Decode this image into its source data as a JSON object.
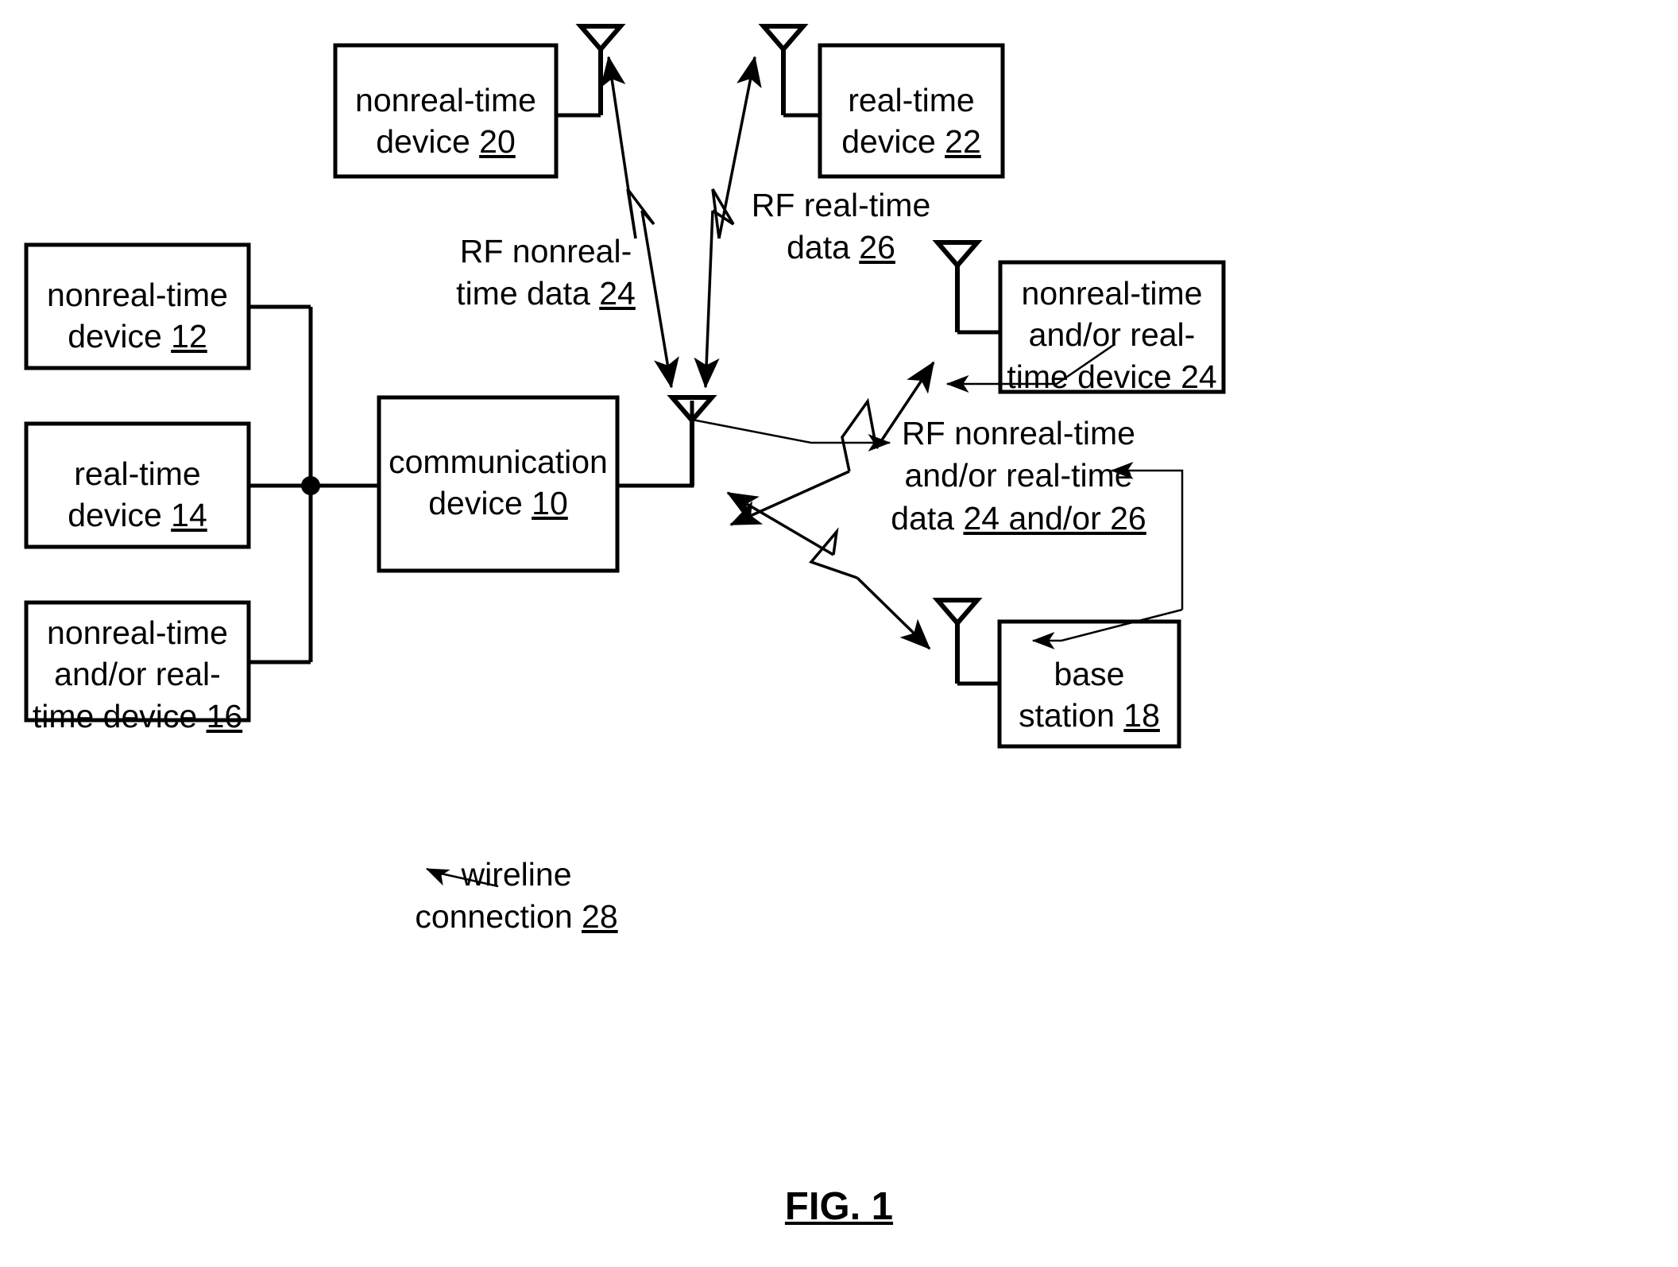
{
  "figure": {
    "caption": "FIG. 1",
    "boxes": [
      {
        "id": "device-20",
        "lines": [
          "nonreal-time",
          "device "
        ],
        "ref": "20"
      },
      {
        "id": "device-22",
        "lines": [
          "real-time",
          "device "
        ],
        "ref": "22"
      },
      {
        "id": "device-12",
        "lines": [
          "nonreal-time",
          "device "
        ],
        "ref": "12"
      },
      {
        "id": "device-14",
        "lines": [
          "real-time",
          "device "
        ],
        "ref": "14"
      },
      {
        "id": "device-16",
        "lines": [
          "nonreal-time",
          "and/or real-",
          "time device "
        ],
        "ref": "16"
      },
      {
        "id": "device-10",
        "lines": [
          "communication",
          "device "
        ],
        "ref": "10"
      },
      {
        "id": "device-24-right",
        "lines": [
          "nonreal-time",
          "and/or real-",
          "time device "
        ],
        "ref": "24"
      },
      {
        "id": "base-station-18",
        "lines": [
          "base",
          "station "
        ],
        "ref": "18"
      }
    ],
    "annotations": [
      {
        "id": "rf-nonreal-time-data-24",
        "lines": [
          "RF nonreal-",
          "time data "
        ],
        "ref": "24"
      },
      {
        "id": "rf-real-time-data-26",
        "lines": [
          "RF real-time",
          "data "
        ],
        "ref": "26"
      },
      {
        "id": "rf-nonreal-and-or-real-time-data",
        "lines": [
          "RF nonreal-time",
          "and/or real-time",
          "data "
        ],
        "ref": "24 and/or 26"
      },
      {
        "id": "wireline-connection-28",
        "lines": [
          "wireline",
          "connection "
        ],
        "ref": "28"
      }
    ],
    "icons": {
      "antenna": "antenna-icon",
      "junction": "junction-dot-icon",
      "lightning": "rf-lightning-bolt-icon"
    },
    "colors": {
      "ink": "#000000",
      "paper": "#ffffff"
    }
  }
}
